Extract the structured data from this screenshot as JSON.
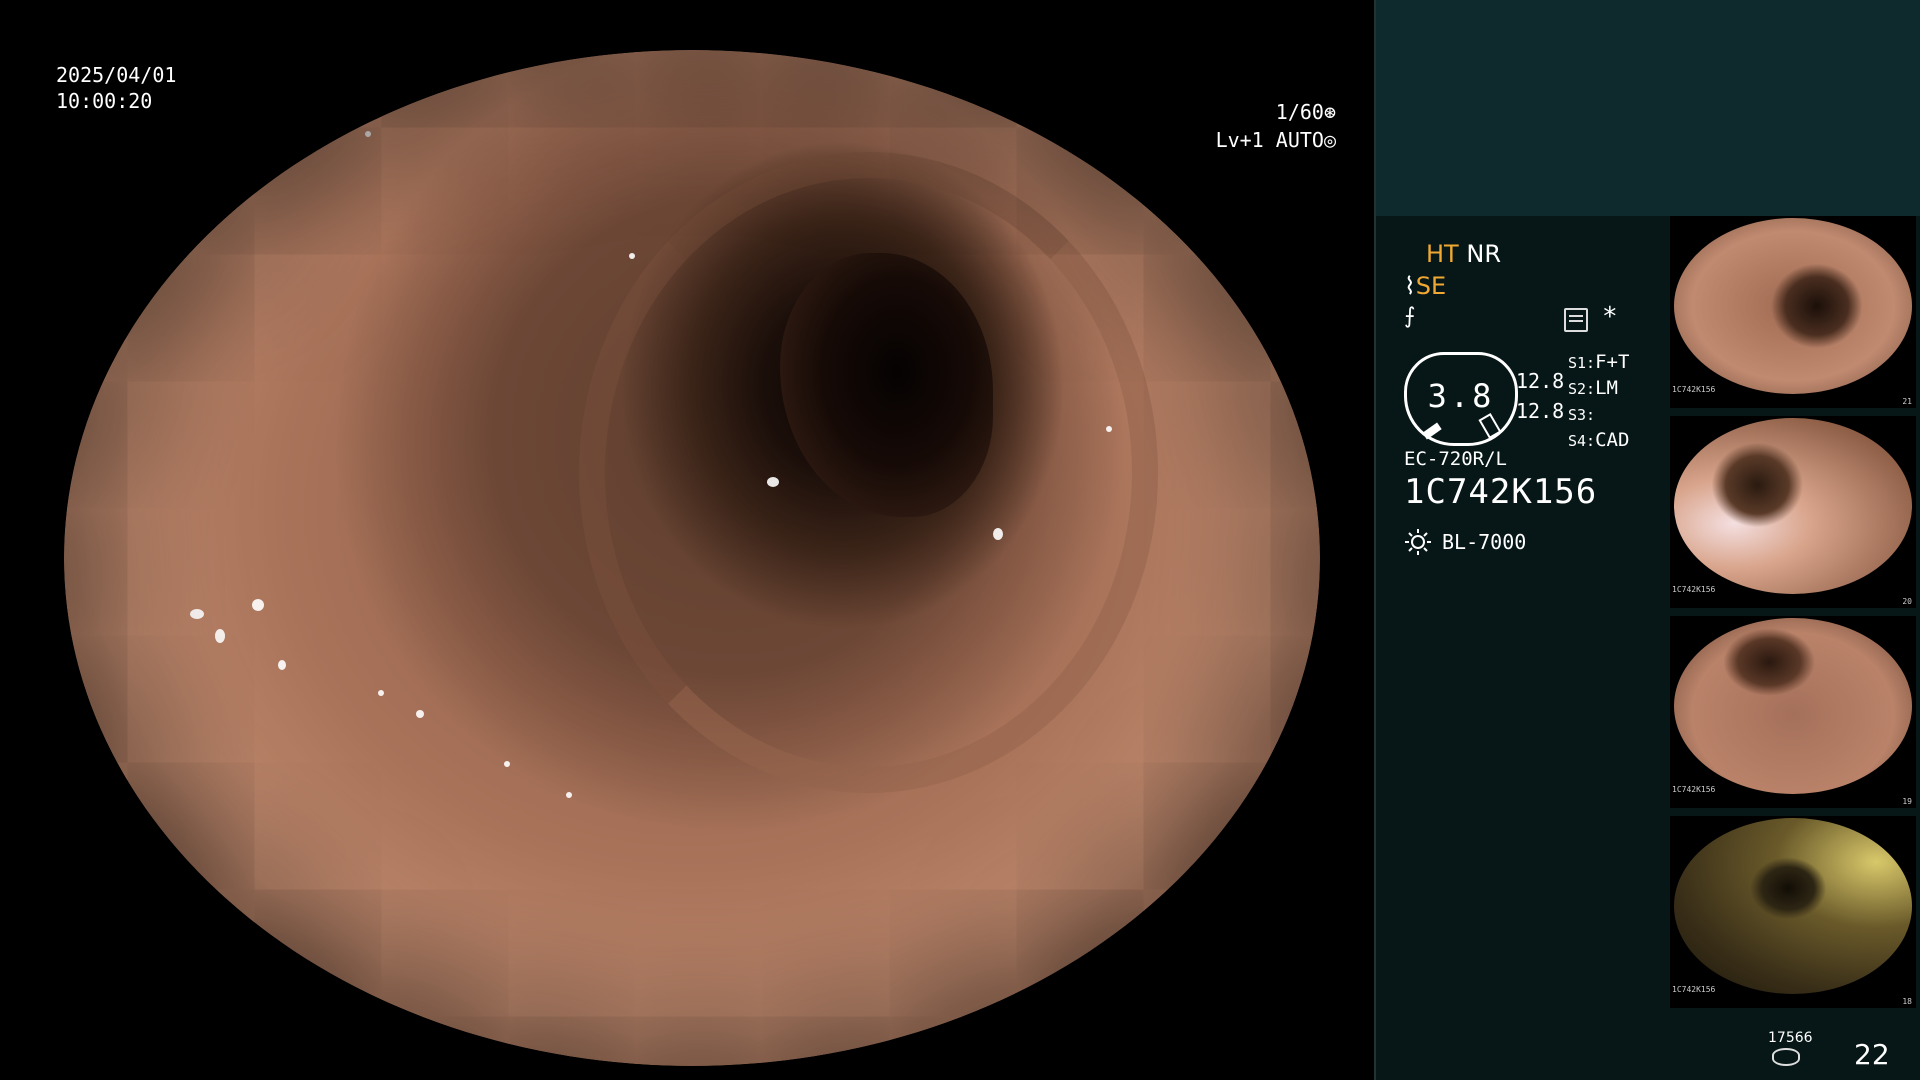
{
  "main": {
    "date": "2025/04/01",
    "time": "10:00:20",
    "shutter": "1/60",
    "shutter_icon": "aperture-icon",
    "level": "Lv+1",
    "iris_mode": "AUTO",
    "iris_icon": "iris-icon"
  },
  "panel": {
    "mode_ht": "HT",
    "mode_nr": "NR",
    "mode_se": "SE",
    "gauge_value": "3.8",
    "gauge_num_1": "12.8",
    "gauge_num_2": "12.8",
    "switches": [
      {
        "key": "S1:",
        "value": "F+T"
      },
      {
        "key": "S2:",
        "value": "LM"
      },
      {
        "key": "S3:",
        "value": ""
      },
      {
        "key": "S4:",
        "value": "CAD"
      }
    ],
    "scope_model": "EC-720R/L",
    "scope_serial": "1C742K156",
    "light_source": "BL-7000",
    "asterisk": "*",
    "image_count_small": "17566",
    "image_count_big": "22",
    "thumbnails": [
      {
        "label": "1C742K156",
        "num": "21"
      },
      {
        "label": "1C742K156",
        "num": "20"
      },
      {
        "label": "1C742K156",
        "num": "19"
      },
      {
        "label": "1C742K156",
        "num": "18"
      }
    ]
  },
  "colors": {
    "accent_orange": "#f0a832",
    "panel_bg": "#071717",
    "panel_top_bg": "#0f2a2c"
  }
}
